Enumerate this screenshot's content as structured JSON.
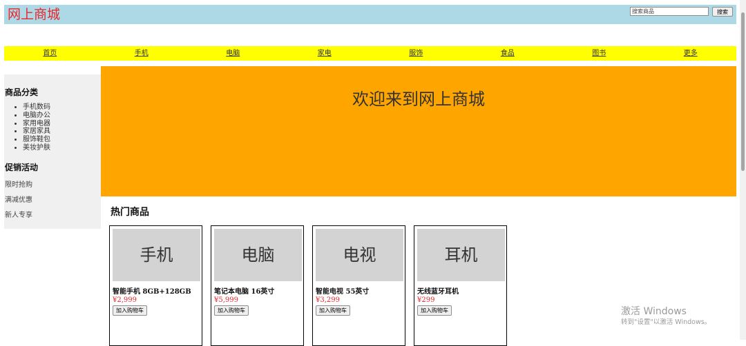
{
  "header": {
    "logo": "网上商城",
    "search_placeholder": "搜索商品",
    "search_button": "搜索"
  },
  "nav": {
    "items": [
      "首页",
      "手机",
      "电脑",
      "家电",
      "服饰",
      "食品",
      "图书",
      "更多"
    ]
  },
  "sidebar": {
    "category_heading": "商品分类",
    "categories": [
      "手机数码",
      "电脑办公",
      "家用电器",
      "家居家具",
      "服饰鞋包",
      "美妆护肤"
    ],
    "promo_heading": "促销活动",
    "promos": [
      "限时抢购",
      "满减优惠",
      "新人专享"
    ]
  },
  "banner": {
    "text": "欢迎来到网上商城"
  },
  "products": {
    "title": "热门商品",
    "button_label": "加入购物车",
    "items": [
      {
        "image_label": "手机",
        "name": "智能手机 8GB+128GB",
        "price": "¥2,999"
      },
      {
        "image_label": "电脑",
        "name": "笔记本电脑 16英寸",
        "price": "¥5,999"
      },
      {
        "image_label": "电视",
        "name": "智能电视 55英寸",
        "price": "¥3,299"
      },
      {
        "image_label": "耳机",
        "name": "无线蓝牙耳机",
        "price": "¥299"
      }
    ]
  },
  "watermark": {
    "title": "激活 Windows",
    "subtitle": "转到\"设置\"以激活 Windows。"
  },
  "colors": {
    "header_bg": "#add8e6",
    "nav_bg": "#ffff00",
    "banner_bg": "#ffa500",
    "price": "#e8262b"
  }
}
